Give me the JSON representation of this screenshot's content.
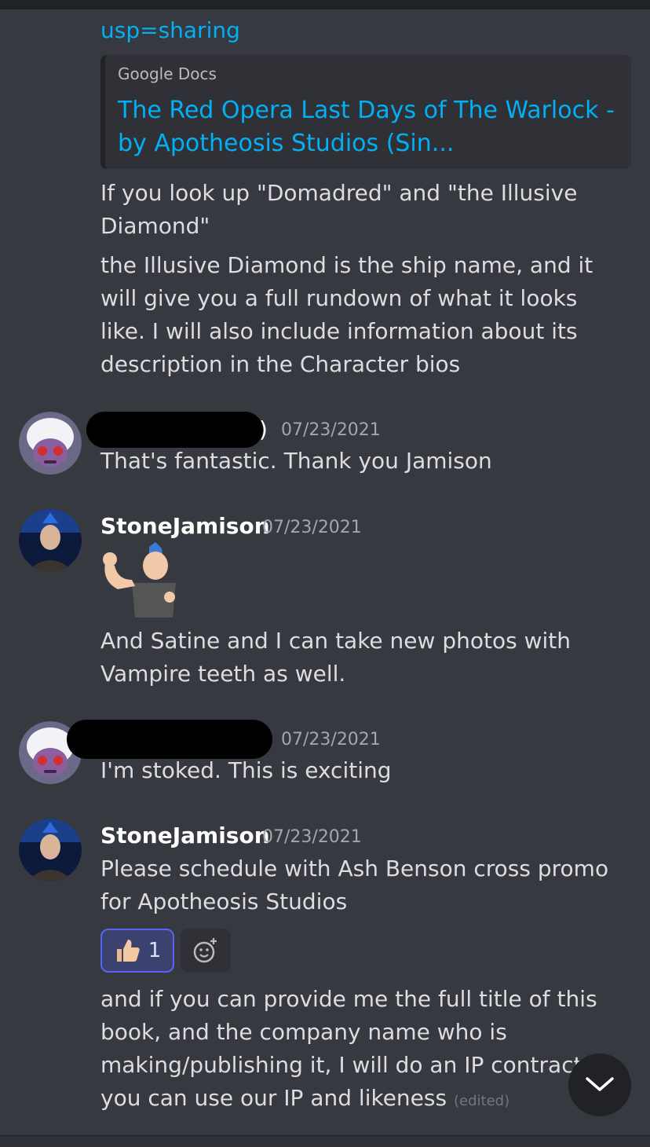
{
  "messages": {
    "link_tail": "usp=sharing",
    "embed": {
      "provider": "Google Docs",
      "title": "The Red Opera Last Days of The Warlock - by Apotheosis Studios (Sin..."
    },
    "text_1": "If you look up \"Domadred\" and \"the Illusive Diamond\"",
    "text_2": "the Illusive Diamond is the ship name, and it will give you a full rundown of what it looks like. I will also include information about its description in the Character bios",
    "group_1": {
      "paren": ")",
      "timestamp": "07/23/2021",
      "text": "That's fantastic. Thank you Jamison"
    },
    "group_2": {
      "username": "StoneJamison",
      "timestamp": "07/23/2021",
      "text": "And Satine and I can take new photos with Vampire teeth as well."
    },
    "group_3": {
      "timestamp": "07/23/2021",
      "text": "I'm stoked. This is exciting"
    },
    "group_4": {
      "username": "StoneJamison",
      "timestamp": "07/23/2021",
      "text_1": "Please schedule with Ash Benson cross promo for Apotheosis Studios",
      "reaction": {
        "emoji": "thumbs-up",
        "count": "1"
      },
      "text_2": "and if you can provide me the full title of this book, and the company name who is making/publishing it, I will do an IP contract so you can use our IP and likeness",
      "edited_label": "(edited)"
    }
  },
  "colors": {
    "background": "#36393f",
    "link": "#00aff4",
    "reaction_active": "#5865f2"
  },
  "icons": {
    "jump": "chevron-down-icon",
    "add_reaction": "add-reaction-icon"
  }
}
